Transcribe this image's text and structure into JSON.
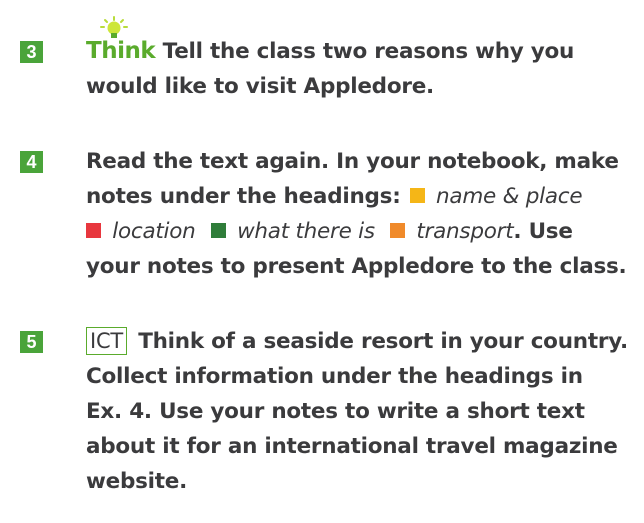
{
  "colors": {
    "number_badge": "#4aa43a",
    "think_green": "#5aab2c",
    "heading_name_place": "#f5b617",
    "heading_location": "#e8373e",
    "heading_what_there_is": "#2f7d3a",
    "heading_transport": "#f08a2a"
  },
  "ex3": {
    "number": "3",
    "think_label": "Think",
    "line1": "Tell the class two reasons why you",
    "line2": "would like to visit Appledore."
  },
  "ex4": {
    "number": "4",
    "line1": "Read the text again. In your notebook, make",
    "line2_prefix": "notes under the headings:",
    "heading1": "name & place",
    "heading2": "location",
    "heading3": "what there is",
    "heading4": "transport",
    "line3_suffix": ". Use",
    "line4": "your notes to present Appledore to the class."
  },
  "ex5": {
    "number": "5",
    "ict_label": "ICT",
    "line1": "Think of a seaside resort in your country.",
    "line2": "Collect information under the headings in",
    "line3": "Ex. 4. Use your notes to write a short text",
    "line4": "about it for an international travel magazine",
    "line5": "website."
  }
}
